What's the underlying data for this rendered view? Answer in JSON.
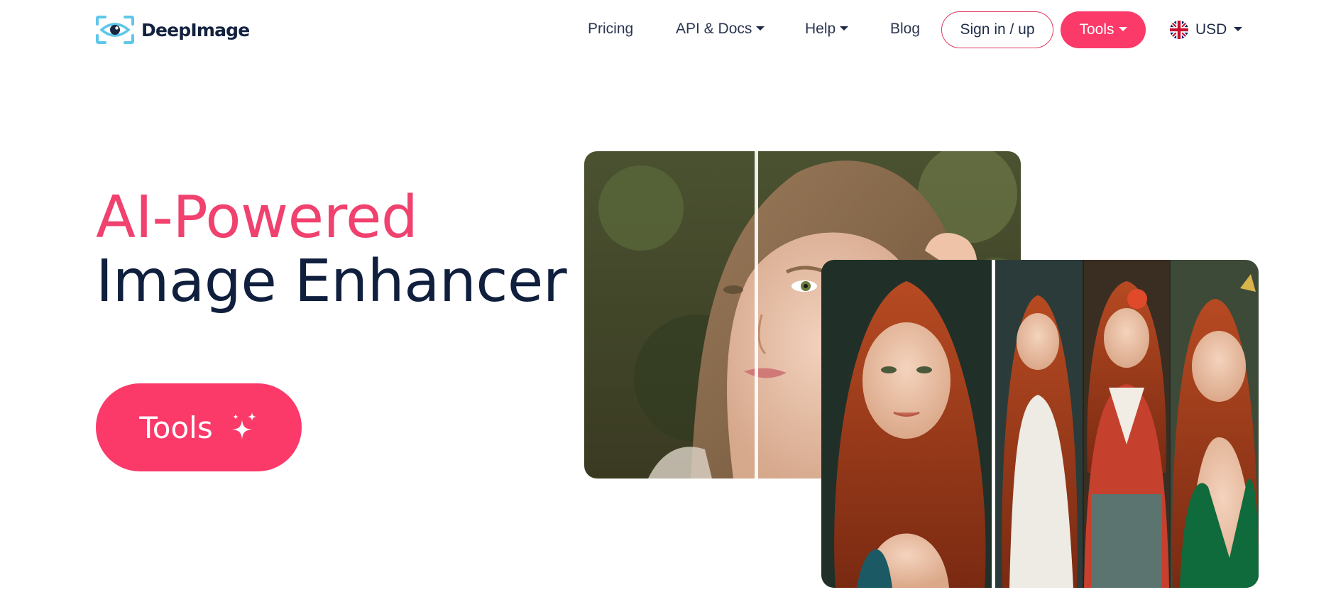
{
  "brand": {
    "name": "DeepImage",
    "accent_color": "#fb3a6a",
    "title_pink": "#f0416f",
    "navy": "#0f1f3d"
  },
  "nav": {
    "pricing": "Pricing",
    "api_docs": "API & Docs",
    "help": "Help",
    "blog": "Blog",
    "sign_in": "Sign in / up",
    "tools": "Tools",
    "currency": "USD",
    "currency_flag": "uk-flag-icon"
  },
  "hero": {
    "title_line1": "AI-Powered",
    "title_line2": "Image Enhancer",
    "cta_label": "Tools",
    "cta_icon": "sparkles-icon"
  },
  "images": {
    "before_after_portrait": "before-after-photo",
    "before_after_collage": "before-after-collage"
  }
}
